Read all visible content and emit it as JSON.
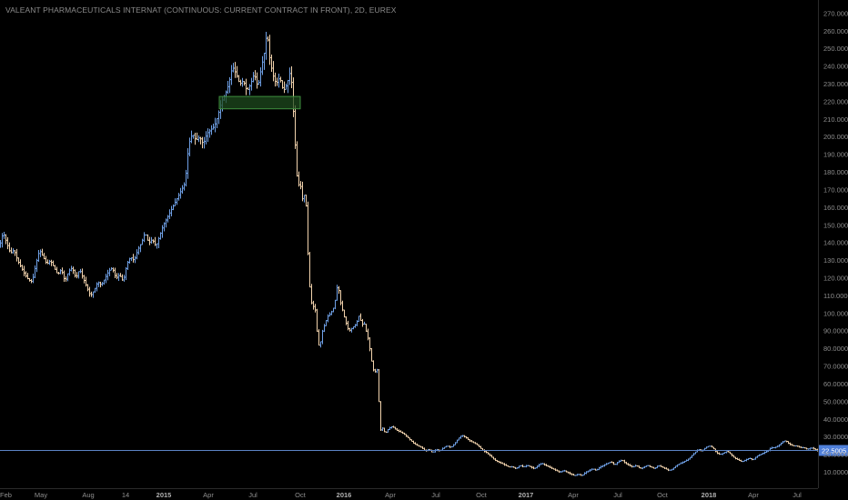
{
  "chart_data": {
    "type": "ohlc",
    "title": "VALEANT PHARMACEUTICALS INTERNAT (CONTINUOUS: CURRENT CONTRACT IN FRONT), 2D, EUREX",
    "y_ticks": [
      "10.0000",
      "20.0000",
      "30.0000",
      "40.0000",
      "50.0000",
      "60.0000",
      "70.0000",
      "80.0000",
      "90.0000",
      "100.0000",
      "110.0000",
      "120.0000",
      "130.0000",
      "140.0000",
      "150.0000",
      "160.0000",
      "170.0000",
      "180.0000",
      "190.0000",
      "200.0000",
      "210.0000",
      "220.0000",
      "230.0000",
      "240.0000",
      "250.0000",
      "260.0000",
      "270.0000"
    ],
    "x_ticks": [
      {
        "label": "Feb",
        "bold": false
      },
      {
        "label": "May",
        "bold": false
      },
      {
        "label": "Aug",
        "bold": false
      },
      {
        "label": "14",
        "bold": false
      },
      {
        "label": "2015",
        "bold": true
      },
      {
        "label": "Apr",
        "bold": false
      },
      {
        "label": "Jul",
        "bold": false
      },
      {
        "label": "Oct",
        "bold": false
      },
      {
        "label": "2016",
        "bold": true
      },
      {
        "label": "Apr",
        "bold": false
      },
      {
        "label": "Jul",
        "bold": false
      },
      {
        "label": "Oct",
        "bold": false
      },
      {
        "label": "2017",
        "bold": true
      },
      {
        "label": "Apr",
        "bold": false
      },
      {
        "label": "Jul",
        "bold": false
      },
      {
        "label": "Oct",
        "bold": false
      },
      {
        "label": "2018",
        "bold": true
      },
      {
        "label": "Apr",
        "bold": false
      },
      {
        "label": "Jul",
        "bold": false
      }
    ],
    "ylim": [
      5,
      275
    ],
    "current_price": "22.5005",
    "price_line": 22.5,
    "support_zone": {
      "from_label": "Apr",
      "to_label": "Oct",
      "low": 216,
      "high": 223
    },
    "series_path": [
      [
        0,
        138
      ],
      [
        4,
        146
      ],
      [
        8,
        140
      ],
      [
        12,
        134
      ],
      [
        16,
        136
      ],
      [
        20,
        130
      ],
      [
        24,
        126
      ],
      [
        28,
        122
      ],
      [
        32,
        119
      ],
      [
        36,
        118
      ],
      [
        40,
        128
      ],
      [
        44,
        136
      ],
      [
        48,
        132
      ],
      [
        52,
        128
      ],
      [
        56,
        130
      ],
      [
        60,
        126
      ],
      [
        64,
        122
      ],
      [
        68,
        125
      ],
      [
        72,
        118
      ],
      [
        76,
        124
      ],
      [
        80,
        126
      ],
      [
        84,
        120
      ],
      [
        88,
        125
      ],
      [
        92,
        120
      ],
      [
        96,
        115
      ],
      [
        100,
        110
      ],
      [
        104,
        113
      ],
      [
        108,
        118
      ],
      [
        112,
        116
      ],
      [
        116,
        120
      ],
      [
        120,
        124
      ],
      [
        124,
        126
      ],
      [
        128,
        120
      ],
      [
        132,
        122
      ],
      [
        136,
        118
      ],
      [
        140,
        128
      ],
      [
        144,
        132
      ],
      [
        148,
        130
      ],
      [
        152,
        136
      ],
      [
        156,
        140
      ],
      [
        160,
        146
      ],
      [
        164,
        140
      ],
      [
        168,
        142
      ],
      [
        172,
        138
      ],
      [
        176,
        144
      ],
      [
        180,
        150
      ],
      [
        184,
        154
      ],
      [
        188,
        158
      ],
      [
        192,
        162
      ],
      [
        196,
        166
      ],
      [
        200,
        170
      ],
      [
        204,
        174
      ],
      [
        208,
        196
      ],
      [
        212,
        202
      ],
      [
        216,
        198
      ],
      [
        220,
        200
      ],
      [
        224,
        196
      ],
      [
        228,
        202
      ],
      [
        232,
        204
      ],
      [
        236,
        206
      ],
      [
        240,
        212
      ],
      [
        244,
        220
      ],
      [
        248,
        224
      ],
      [
        252,
        230
      ],
      [
        256,
        240
      ],
      [
        260,
        236
      ],
      [
        264,
        230
      ],
      [
        268,
        232
      ],
      [
        272,
        226
      ],
      [
        276,
        230
      ],
      [
        280,
        236
      ],
      [
        284,
        228
      ],
      [
        288,
        240
      ],
      [
        292,
        250
      ],
      [
        294,
        262
      ],
      [
        296,
        248
      ],
      [
        300,
        236
      ],
      [
        304,
        230
      ],
      [
        308,
        234
      ],
      [
        312,
        226
      ],
      [
        316,
        230
      ],
      [
        320,
        238
      ],
      [
        322,
        224
      ],
      [
        324,
        205
      ],
      [
        326,
        186
      ],
      [
        328,
        170
      ],
      [
        330,
        176
      ],
      [
        332,
        168
      ],
      [
        334,
        162
      ],
      [
        336,
        172
      ],
      [
        338,
        150
      ],
      [
        340,
        118
      ],
      [
        342,
        112
      ],
      [
        344,
        100
      ],
      [
        346,
        108
      ],
      [
        348,
        96
      ],
      [
        350,
        84
      ],
      [
        352,
        80
      ],
      [
        354,
        88
      ],
      [
        356,
        92
      ],
      [
        358,
        94
      ],
      [
        360,
        98
      ],
      [
        364,
        100
      ],
      [
        368,
        104
      ],
      [
        372,
        118
      ],
      [
        374,
        108
      ],
      [
        376,
        104
      ],
      [
        380,
        96
      ],
      [
        384,
        90
      ],
      [
        388,
        92
      ],
      [
        392,
        94
      ],
      [
        396,
        100
      ],
      [
        398,
        92
      ],
      [
        400,
        96
      ],
      [
        402,
        92
      ],
      [
        404,
        88
      ],
      [
        406,
        84
      ],
      [
        408,
        76
      ],
      [
        410,
        70
      ],
      [
        412,
        66
      ],
      [
        414,
        68
      ],
      [
        416,
        68
      ],
      [
        418,
        32
      ],
      [
        420,
        36
      ],
      [
        424,
        32
      ],
      [
        428,
        35
      ],
      [
        432,
        36
      ],
      [
        436,
        34
      ],
      [
        440,
        33
      ],
      [
        444,
        32
      ],
      [
        448,
        30
      ],
      [
        452,
        28
      ],
      [
        456,
        26
      ],
      [
        460,
        25
      ],
      [
        464,
        24
      ],
      [
        468,
        22
      ],
      [
        472,
        23
      ],
      [
        476,
        21
      ],
      [
        480,
        23
      ],
      [
        484,
        22
      ],
      [
        488,
        24
      ],
      [
        492,
        25
      ],
      [
        496,
        24
      ],
      [
        500,
        26
      ],
      [
        504,
        29
      ],
      [
        508,
        31
      ],
      [
        512,
        30
      ],
      [
        516,
        28
      ],
      [
        520,
        27
      ],
      [
        524,
        26
      ],
      [
        528,
        24
      ],
      [
        532,
        22
      ],
      [
        536,
        21
      ],
      [
        540,
        19
      ],
      [
        544,
        17
      ],
      [
        548,
        16
      ],
      [
        552,
        15
      ],
      [
        556,
        14
      ],
      [
        560,
        13
      ],
      [
        564,
        13
      ],
      [
        568,
        12
      ],
      [
        572,
        14
      ],
      [
        576,
        13
      ],
      [
        580,
        14
      ],
      [
        584,
        13
      ],
      [
        588,
        12
      ],
      [
        592,
        14
      ],
      [
        596,
        15
      ],
      [
        600,
        14
      ],
      [
        604,
        13
      ],
      [
        608,
        12
      ],
      [
        612,
        11
      ],
      [
        616,
        10
      ],
      [
        620,
        11
      ],
      [
        624,
        10
      ],
      [
        628,
        9
      ],
      [
        632,
        8
      ],
      [
        636,
        9
      ],
      [
        640,
        8
      ],
      [
        644,
        10
      ],
      [
        648,
        11
      ],
      [
        652,
        12
      ],
      [
        656,
        11
      ],
      [
        660,
        13
      ],
      [
        664,
        14
      ],
      [
        668,
        15
      ],
      [
        672,
        16
      ],
      [
        676,
        14
      ],
      [
        680,
        16
      ],
      [
        684,
        17
      ],
      [
        688,
        15
      ],
      [
        692,
        14
      ],
      [
        696,
        13
      ],
      [
        700,
        14
      ],
      [
        704,
        12
      ],
      [
        708,
        13
      ],
      [
        712,
        14
      ],
      [
        716,
        13
      ],
      [
        720,
        12
      ],
      [
        724,
        14
      ],
      [
        728,
        13
      ],
      [
        732,
        12
      ],
      [
        736,
        11
      ],
      [
        740,
        12
      ],
      [
        744,
        14
      ],
      [
        748,
        15
      ],
      [
        752,
        16
      ],
      [
        756,
        17
      ],
      [
        760,
        19
      ],
      [
        764,
        21
      ],
      [
        768,
        23
      ],
      [
        772,
        22
      ],
      [
        776,
        24
      ],
      [
        780,
        25
      ],
      [
        784,
        24
      ],
      [
        788,
        21
      ],
      [
        792,
        20
      ],
      [
        796,
        21
      ],
      [
        800,
        22
      ],
      [
        804,
        20
      ],
      [
        808,
        18
      ],
      [
        812,
        17
      ],
      [
        816,
        16
      ],
      [
        820,
        17
      ],
      [
        824,
        18
      ],
      [
        828,
        17
      ],
      [
        832,
        19
      ],
      [
        836,
        20
      ],
      [
        840,
        21
      ],
      [
        844,
        22
      ],
      [
        848,
        24
      ],
      [
        852,
        24
      ],
      [
        856,
        25
      ],
      [
        860,
        27
      ],
      [
        864,
        28
      ],
      [
        868,
        26
      ],
      [
        872,
        25
      ],
      [
        876,
        25
      ],
      [
        880,
        24
      ],
      [
        884,
        24
      ],
      [
        888,
        23
      ],
      [
        892,
        24
      ],
      [
        896,
        23
      ],
      [
        900,
        22
      ]
    ],
    "colors": {
      "background": "#000000",
      "up_bar": "#6fa0e6",
      "down_bar": "#f2d3ad",
      "axis_text": "#8e8e8e",
      "price_line": "#5b83c4",
      "price_label_bg": "#4f7fd9",
      "zone_fill": "#1e4a1e",
      "zone_stroke": "#3e8e3e"
    },
    "grid": false
  }
}
